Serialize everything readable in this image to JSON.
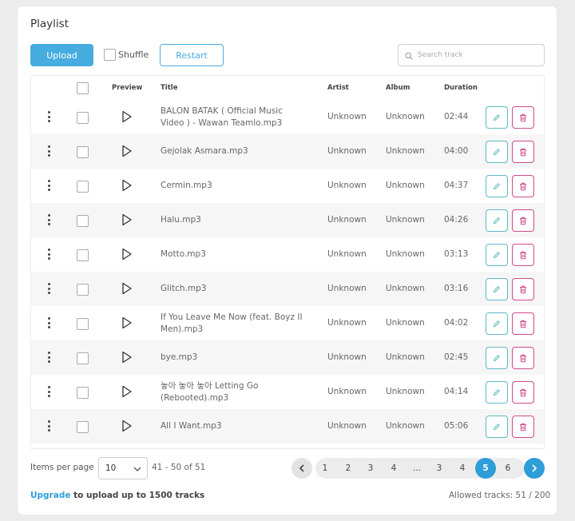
{
  "panel": {
    "title": "Playlist"
  },
  "toolbar": {
    "upload_label": "Upload",
    "shuffle_label": "Shuffle",
    "shuffle_checked": false,
    "restart_label": "Restart",
    "search_placeholder": "Search track",
    "search_value": ""
  },
  "table": {
    "headers": {
      "preview": "Preview",
      "title": "Title",
      "artist": "Artist",
      "album": "Album",
      "duration": "Duration"
    },
    "rows": [
      {
        "title": "BALON BATAK ( Official Music Video ) - Wawan Teamlo.mp3",
        "artist": "Unknown",
        "album": "Unknown",
        "duration": "02:44"
      },
      {
        "title": "Gejolak Asmara.mp3",
        "artist": "Unknown",
        "album": "Unknown",
        "duration": "04:00"
      },
      {
        "title": "Cermin.mp3",
        "artist": "Unknown",
        "album": "Unknown",
        "duration": "04:37"
      },
      {
        "title": "Halu.mp3",
        "artist": "Unknown",
        "album": "Unknown",
        "duration": "04:26"
      },
      {
        "title": "Motto.mp3",
        "artist": "Unknown",
        "album": "Unknown",
        "duration": "03:13"
      },
      {
        "title": "Glitch.mp3",
        "artist": "Unknown",
        "album": "Unknown",
        "duration": "03:16"
      },
      {
        "title": "If You Leave Me Now (feat. Boyz II Men).mp3",
        "artist": "Unknown",
        "album": "Unknown",
        "duration": "04:02"
      },
      {
        "title": "bye.mp3",
        "artist": "Unknown",
        "album": "Unknown",
        "duration": "02:45"
      },
      {
        "title": "놓아 놓아 놓아 Letting Go (Rebooted).mp3",
        "artist": "Unknown",
        "album": "Unknown",
        "duration": "04:14"
      },
      {
        "title": "All I Want.mp3",
        "artist": "Unknown",
        "album": "Unknown",
        "duration": "05:06"
      }
    ]
  },
  "footer": {
    "items_per_page_label": "Items per page",
    "items_per_page_value": "10",
    "range_text": "41 - 50 of 51",
    "pages": [
      "1",
      "2",
      "3",
      "4",
      "...",
      "3",
      "4",
      "5",
      "6"
    ],
    "active_page": "5",
    "upgrade_link": "Upgrade",
    "upgrade_text": " to upload up to 1500 tracks",
    "allowed_text": "Allowed tracks: 51 / 200"
  },
  "colors": {
    "accent": "#47ace0",
    "edit": "#5fb8c8",
    "delete": "#cf4a8c"
  }
}
